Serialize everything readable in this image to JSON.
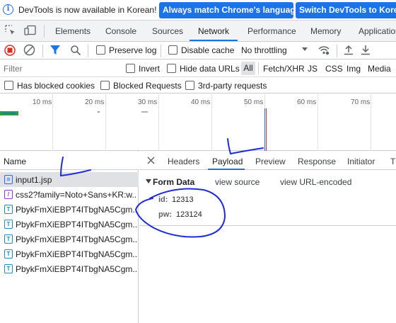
{
  "infobar": {
    "icon": "info-icon",
    "message": "DevTools is now available in Korean!",
    "match_button": "Always match Chrome's language",
    "switch_button": "Switch DevTools to Korean"
  },
  "panel_tabs": [
    "Elements",
    "Console",
    "Sources",
    "Network",
    "Performance",
    "Memory",
    "Application"
  ],
  "active_panel": "Network",
  "toolbar": {
    "preserve_log": "Preserve log",
    "disable_cache": "Disable cache",
    "throttling": "No throttling"
  },
  "filter": {
    "placeholder": "Filter",
    "invert": "Invert",
    "hide_data_urls": "Hide data URLs",
    "types": [
      "All",
      "Fetch/XHR",
      "JS",
      "CSS",
      "Img",
      "Media"
    ]
  },
  "blocked": {
    "has_blocked_cookies": "Has blocked cookies",
    "blocked_requests": "Blocked Requests",
    "third_party": "3rd-party requests"
  },
  "timeline": {
    "ticks": [
      "10 ms",
      "20 ms",
      "30 ms",
      "40 ms",
      "50 ms",
      "60 ms",
      "70 ms"
    ]
  },
  "requests": {
    "header": "Name",
    "rows": [
      {
        "name": "input1.jsp",
        "icon": "document-icon"
      },
      {
        "name": "css2?family=Noto+Sans+KR:w...",
        "icon": "stylesheet-icon"
      },
      {
        "name": "PbykFmXiEBPT4ITbgNA5Cgm...",
        "icon": "font-icon"
      },
      {
        "name": "PbykFmXiEBPT4ITbgNA5Cgm...",
        "icon": "font-icon"
      },
      {
        "name": "PbykFmXiEBPT4ITbgNA5Cgm...",
        "icon": "font-icon"
      },
      {
        "name": "PbykFmXiEBPT4ITbgNA5Cgm...",
        "icon": "font-icon"
      },
      {
        "name": "PbykFmXiEBPT4ITbgNA5Cgm...",
        "icon": "font-icon"
      }
    ]
  },
  "detail": {
    "tabs": [
      "Headers",
      "Payload",
      "Preview",
      "Response",
      "Initiator",
      "T"
    ],
    "active_tab": "Payload",
    "section_title": "Form Data",
    "view_source": "view source",
    "view_url_encoded": "view URL-encoded",
    "fields": [
      {
        "key": "id:",
        "value": "12313"
      },
      {
        "key": "pw:",
        "value": "123124"
      }
    ]
  },
  "colors": {
    "accent": "#1a73e8",
    "record_red": "#d93025",
    "annotation_ink": "#1f2bd6"
  }
}
